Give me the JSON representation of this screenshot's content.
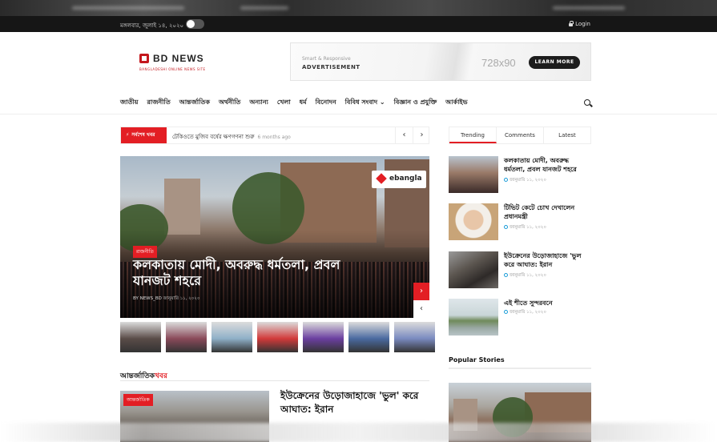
{
  "topbar": {
    "date": "মঙ্গলবার, জুলাই ১৪, ২০২০",
    "login_label": "Login"
  },
  "logo": {
    "name": "BD NEWS",
    "tagline": "BANGLADESHI ONLINE NEWS SITE"
  },
  "ad": {
    "subtitle": "Smart & Responsive",
    "title": "ADVERTISEMENT",
    "size": "728x90",
    "button": "LEARN MORE"
  },
  "nav": {
    "items": [
      "জাতীয়",
      "রাজনীতি",
      "আন্তর্জাতিক",
      "অর্থনীতি",
      "অন্যান্য",
      "খেলা",
      "ধর্ম",
      "বিনোদন",
      "বিবিধ সংবাদ ⌄",
      "বিজ্ঞান ও প্রযুক্তি",
      "আর্কাইভ"
    ]
  },
  "breaking": {
    "label": "সর্বশেষ খবর",
    "headline": "টেকিওতে মুজিব বর্ষের ক্ষণগণনা শুরু",
    "ago": "6 months ago",
    "prev": "‹",
    "next": "›"
  },
  "hero": {
    "watermark": "ebangla",
    "category": "রাজনীতি",
    "title": "কলকাতায় মোদী, অবরুদ্ধ ধর্মতলা, প্রবল যানজট শহরে",
    "author": "BY NEWS_BD",
    "date": "জানুয়ারি ১১, ২০২০",
    "next": "›",
    "prev": "‹"
  },
  "thumbs": [
    "#5a4c48",
    "#8a4a5a",
    "#8fb0c8",
    "#d23a3a",
    "#6b3fa0",
    "#4a6aa0",
    "#7a8ac0"
  ],
  "section": {
    "title_part1": "আন্তর্জাতিক",
    "title_part2": "খবর"
  },
  "intl": {
    "category": "আন্তর্জাতিক",
    "title": "ইউক্রেনের উড়োজাহাজে 'ভুল' করে আঘাত: ইরান"
  },
  "tabs": [
    "Trending",
    "Comments",
    "Latest"
  ],
  "sidebar": [
    {
      "title": "কলকাতায় মোদী, অবরুদ্ধ ধর্মতলা, প্রবল যানজট শহরে",
      "date": "জানুয়ারি ১১, ২০২০"
    },
    {
      "title": "টিভিট কেটে চোখ দেখালেন প্রধানমন্ত্রী",
      "date": "জানুয়ারি ১১, ২০২০"
    },
    {
      "title": "ইউক্রেনের উড়োজাহাজে 'ভুল করে আঘাত: ইরান",
      "date": "জানুয়ারি ১১, ২০২০"
    },
    {
      "title": "এই শীতে সুন্দরবনে",
      "date": "জানুয়ারি ১১, ২০২০"
    }
  ],
  "popular": {
    "title": "Popular Stories"
  },
  "colors": {
    "accent": "#e31e24",
    "topbar": "#161616"
  }
}
